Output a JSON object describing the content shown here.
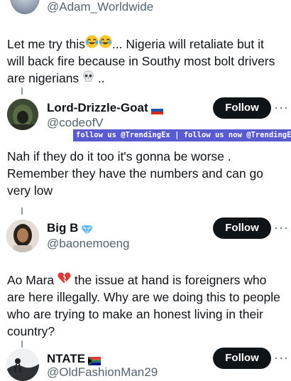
{
  "posts": [
    {
      "handle": "@Adam_Worldwide",
      "text_lines": [
        "Let me try this",
        "... Nigeria will retaliate but it",
        "will back fire because in Southy most bolt drivers",
        "are nigerians",
        " .."
      ]
    },
    {
      "name": "Lord-Drizzle-Goat",
      "handle": "@codeofV",
      "follow_label": "Follow",
      "more_label": "···",
      "text_lines": [
        "Nah if they do it too it's gonna be worse .",
        "Remember they have the numbers and can go",
        "very low"
      ]
    },
    {
      "name": "Big B",
      "handle": "@baonemoeng",
      "follow_label": "Follow",
      "more_label": "···",
      "text_lines": [
        "Ao Mara",
        " the issue at hand is foreigners who",
        "are here illegally. Why are we doing this to people",
        "who are trying to make an honest living in their",
        "country?"
      ]
    },
    {
      "name": "NTATE",
      "handle": "@OldFashionMan29",
      "follow_label": "Follow",
      "more_label": "···"
    }
  ],
  "banner": {
    "text": "follow us @TrendingEx | follow us now @TrendingE"
  },
  "icons": {
    "laugh_emoji": "face-with-tears-of-joy-icon",
    "skull_emoji": "skull-icon",
    "broken_heart_emoji": "broken-heart-icon",
    "russia_flag": "russia-flag-icon",
    "verified_badge": "blue-diamond-icon",
    "south_africa_flag": "south-africa-flag-icon"
  },
  "colors": {
    "text": "#0f1419",
    "secondary": "#536471",
    "button": "#0f1419",
    "banner": "#5a5bd0"
  }
}
